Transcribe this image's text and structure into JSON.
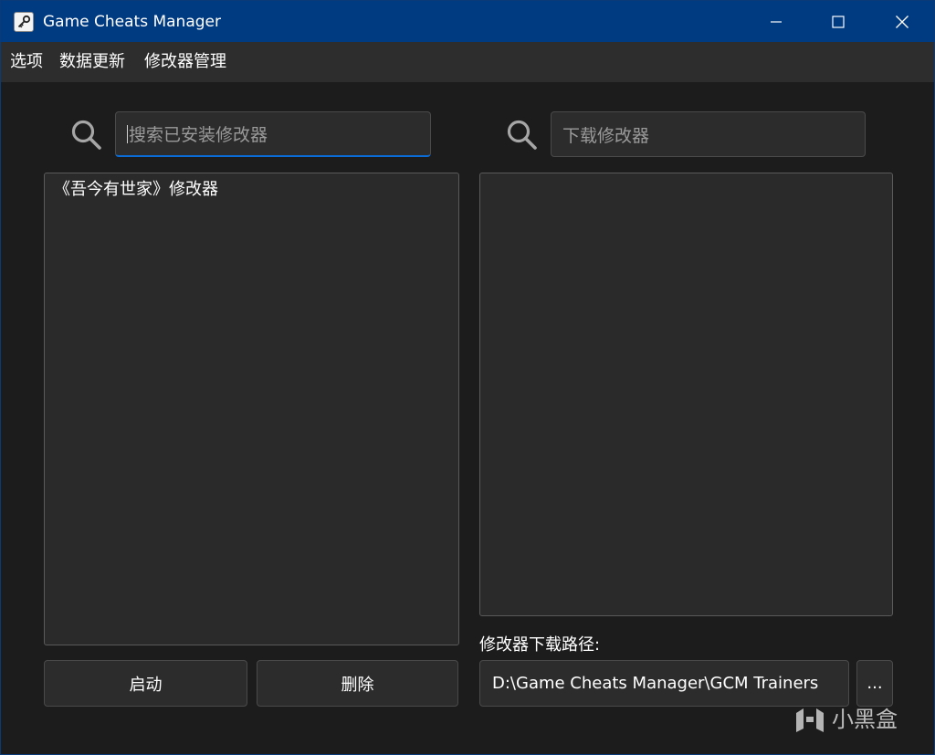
{
  "window": {
    "title": "Game Cheats Manager",
    "controls": {
      "minimize_icon": "minimize-icon",
      "maximize_icon": "maximize-icon",
      "close_icon": "close-icon"
    }
  },
  "menu": {
    "items": [
      {
        "label": "选项"
      },
      {
        "label": "数据更新"
      },
      {
        "label": "修改器管理"
      }
    ]
  },
  "installed": {
    "search_placeholder": "搜索已安装修改器",
    "search_icon": "search-icon",
    "items": [
      {
        "label": "《吾今有世家》修改器"
      }
    ],
    "launch_label": "启动",
    "delete_label": "删除"
  },
  "download": {
    "search_placeholder": "下载修改器",
    "search_icon": "search-icon",
    "items": [],
    "path_label": "修改器下载路径:",
    "path_value": "D:\\Game Cheats Manager\\GCM Trainers",
    "browse_label": "..."
  },
  "watermark": {
    "text": "小黑盒"
  },
  "colors": {
    "titlebar": "#003a80",
    "menubar": "#2d2d2d",
    "background": "#1c1c1c",
    "panel": "#2a2a2a",
    "accent": "#0a6cd6"
  }
}
